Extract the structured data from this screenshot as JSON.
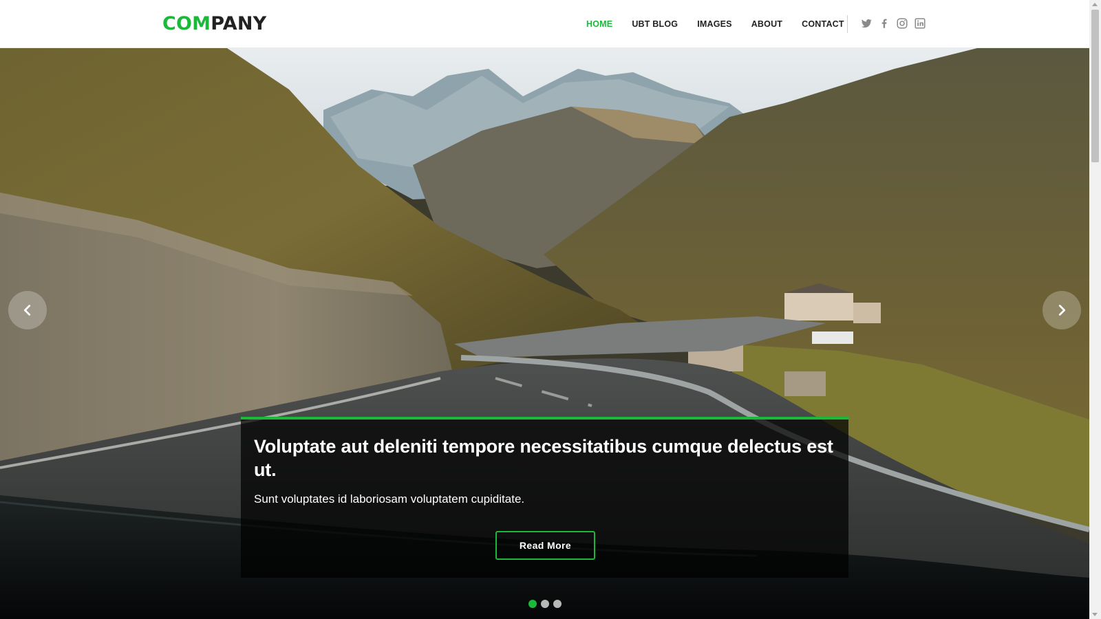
{
  "brand": {
    "logo_accent": "COM",
    "logo_rest": "PANY",
    "accent_color": "#1bb83a"
  },
  "nav": {
    "items": [
      {
        "label": "HOME",
        "active": true
      },
      {
        "label": "UBT BLOG",
        "active": false
      },
      {
        "label": "IMAGES",
        "active": false
      },
      {
        "label": "ABOUT",
        "active": false
      },
      {
        "label": "CONTACT",
        "active": false
      }
    ]
  },
  "social": {
    "icons": [
      "twitter-icon",
      "facebook-icon",
      "instagram-icon",
      "linkedin-icon"
    ]
  },
  "hero": {
    "background": "mountain-road-landscape",
    "caption": {
      "title": "Voluptate aut deleniti tempore necessitatibus cumque delectus est ut.",
      "text": "Sunt voluptates id laboriosam voluptatem cupiditate.",
      "button_label": "Read More"
    },
    "slides_count": 3,
    "active_slide": 1
  }
}
